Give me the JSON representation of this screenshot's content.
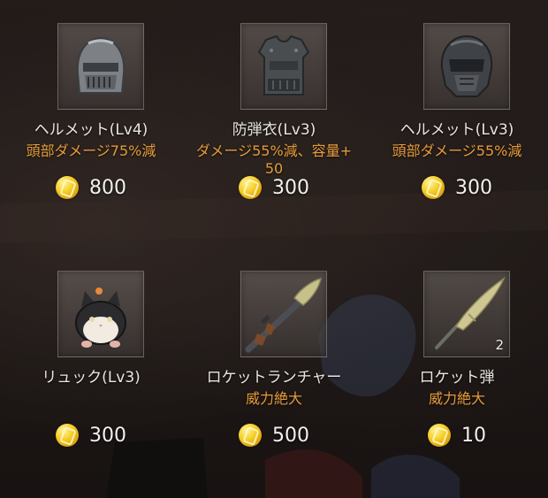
{
  "shop": {
    "items": [
      {
        "name": "ヘルメット(Lv4)",
        "effect": "頭部ダメージ75%減",
        "price": "800",
        "icon": "steel-helmet-icon",
        "count": ""
      },
      {
        "name": "防弾衣(Lv3)",
        "effect": "ダメージ55%減、容量+50",
        "price": "300",
        "icon": "body-armor-icon",
        "count": ""
      },
      {
        "name": "ヘルメット(Lv3)",
        "effect": "頭部ダメージ55%減",
        "price": "300",
        "icon": "tactical-helmet-icon",
        "count": ""
      },
      {
        "name": "リュック(Lv3)",
        "effect": "",
        "price": "300",
        "icon": "cat-backpack-icon",
        "count": ""
      },
      {
        "name": "ロケットランチャー",
        "effect": "威力絶大",
        "price": "500",
        "icon": "rocket-launcher-icon",
        "count": ""
      },
      {
        "name": "ロケット弾",
        "effect": "威力絶大",
        "price": "10",
        "icon": "rocket-ammo-icon",
        "count": "2"
      }
    ]
  },
  "colors": {
    "effect_text": "#e69b3a",
    "name_text": "#e9e6e2",
    "coin": "#f6cf2a"
  }
}
